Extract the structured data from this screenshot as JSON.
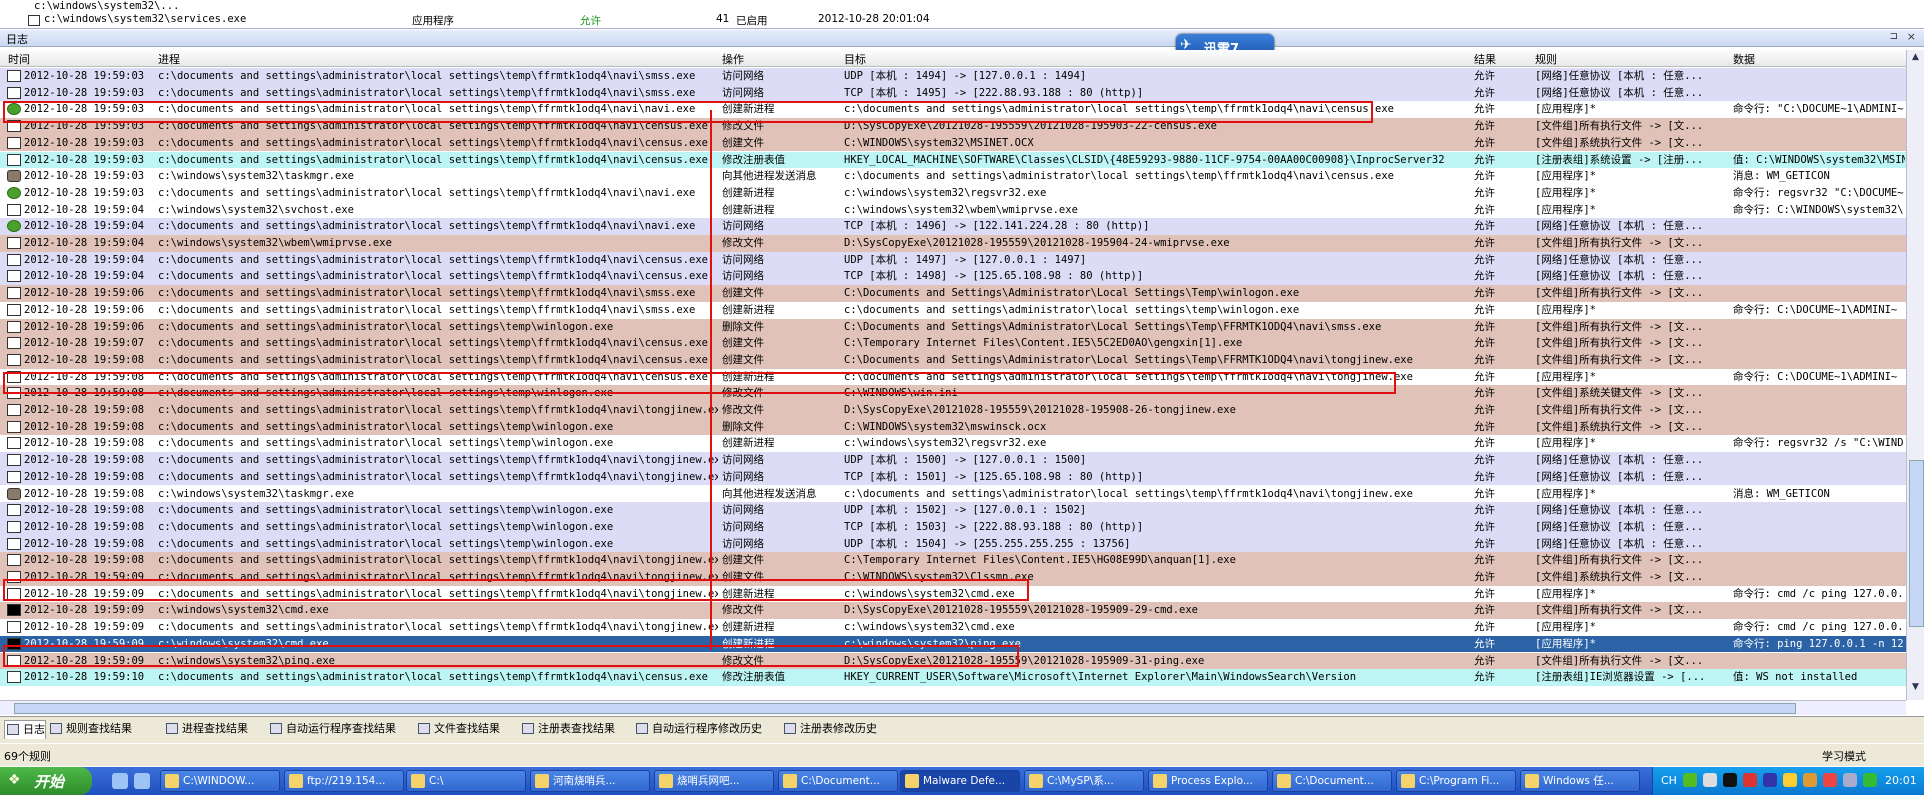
{
  "top_strip": {
    "row1": {
      "path": "c:\\windows\\system32\\...",
      "type": "",
      "status": "",
      "count": "",
      "state": "",
      "time": ""
    },
    "row2": {
      "path": "c:\\windows\\system32\\services.exe",
      "type": "应用程序",
      "status": "允许",
      "count": "41",
      "state": "已启用",
      "time": "2012-10-28 20:01:04"
    }
  },
  "log_panel": {
    "title": "日志",
    "pin": "⊐",
    "close": "×"
  },
  "xunlei": {
    "label": "迅雷7"
  },
  "columns": {
    "time": "时间",
    "process": "进程",
    "operation": "操作",
    "target": "目标",
    "result": "结果",
    "rule": "规则",
    "data": "数据"
  },
  "rows": [
    {
      "bg": "lav",
      "icon": "w",
      "time": "2012-10-28 19:59:03",
      "proc": "c:\\documents and settings\\administrator\\local settings\\temp\\ffrmtk1odq4\\navi\\smss.exe",
      "op": "访问网络",
      "target": "UDP [本机 : 1494] -> [127.0.0.1 : 1494]",
      "res": "允许",
      "rule": "[网络]任意协议 [本机 : 任意...",
      "data": ""
    },
    {
      "bg": "lav",
      "icon": "w",
      "time": "2012-10-28 19:59:03",
      "proc": "c:\\documents and settings\\administrator\\local settings\\temp\\ffrmtk1odq4\\navi\\smss.exe",
      "op": "访问网络",
      "target": "TCP [本机 : 1495] -> [222.88.93.188 : 80 (http)]",
      "res": "允许",
      "rule": "[网络]任意协议 [本机 : 任意...",
      "data": ""
    },
    {
      "bg": "white",
      "icon": "g",
      "time": "2012-10-28 19:59:03",
      "proc": "c:\\documents and settings\\administrator\\local settings\\temp\\ffrmtk1odq4\\navi\\navi.exe",
      "op": "创建新进程",
      "target": "c:\\documents and settings\\administrator\\local settings\\temp\\ffrmtk1odq4\\navi\\census.exe",
      "res": "允许",
      "rule": "[应用程序]*",
      "data": "命令行: \"C:\\DOCUME~1\\ADMINI~"
    },
    {
      "bg": "pink",
      "icon": "w",
      "time": "2012-10-28 19:59:03",
      "proc": "c:\\documents and settings\\administrator\\local settings\\temp\\ffrmtk1odq4\\navi\\census.exe",
      "op": "修改文件",
      "target": "D:\\SysCopyExe\\20121028-195559\\20121028-195903-22-census.exe",
      "res": "允许",
      "rule": "[文件组]所有执行文件 -> [文...",
      "data": ""
    },
    {
      "bg": "pink",
      "icon": "w",
      "time": "2012-10-28 19:59:03",
      "proc": "c:\\documents and settings\\administrator\\local settings\\temp\\ffrmtk1odq4\\navi\\census.exe",
      "op": "创建文件",
      "target": "C:\\WINDOWS\\system32\\MSINET.OCX",
      "res": "允许",
      "rule": "[文件组]系统执行文件 -> [文...",
      "data": ""
    },
    {
      "bg": "cyan",
      "icon": "w",
      "time": "2012-10-28 19:59:03",
      "proc": "c:\\documents and settings\\administrator\\local settings\\temp\\ffrmtk1odq4\\navi\\census.exe",
      "op": "修改注册表值",
      "target": "HKEY_LOCAL_MACHINE\\SOFTWARE\\Classes\\CLSID\\{48E59293-9880-11CF-9754-00AA00C00908}\\InprocServer32",
      "res": "允许",
      "rule": "[注册表组]系统设置 -> [注册...",
      "data": "值: C:\\WINDOWS\\system32\\MSIN"
    },
    {
      "bg": "white",
      "icon": "u",
      "time": "2012-10-28 19:59:03",
      "proc": "c:\\windows\\system32\\taskmgr.exe",
      "op": "向其他进程发送消息",
      "target": "c:\\documents and settings\\administrator\\local settings\\temp\\ffrmtk1odq4\\navi\\census.exe",
      "res": "允许",
      "rule": "[应用程序]*",
      "data": "消息: WM_GETICON"
    },
    {
      "bg": "white",
      "icon": "g",
      "time": "2012-10-28 19:59:03",
      "proc": "c:\\documents and settings\\administrator\\local settings\\temp\\ffrmtk1odq4\\navi\\navi.exe",
      "op": "创建新进程",
      "target": "c:\\windows\\system32\\regsvr32.exe",
      "res": "允许",
      "rule": "[应用程序]*",
      "data": "命令行: regsvr32 \"C:\\DOCUME~"
    },
    {
      "bg": "white",
      "icon": "w",
      "time": "2012-10-28 19:59:04",
      "proc": "c:\\windows\\system32\\svchost.exe",
      "op": "创建新进程",
      "target": "c:\\windows\\system32\\wbem\\wmiprvse.exe",
      "res": "允许",
      "rule": "[应用程序]*",
      "data": "命令行: C:\\WINDOWS\\system32\\"
    },
    {
      "bg": "lav",
      "icon": "g",
      "time": "2012-10-28 19:59:04",
      "proc": "c:\\documents and settings\\administrator\\local settings\\temp\\ffrmtk1odq4\\navi\\navi.exe",
      "op": "访问网络",
      "target": "TCP [本机 : 1496] -> [122.141.224.28 : 80 (http)]",
      "res": "允许",
      "rule": "[网络]任意协议 [本机 : 任意...",
      "data": ""
    },
    {
      "bg": "pink",
      "icon": "w",
      "time": "2012-10-28 19:59:04",
      "proc": "c:\\windows\\system32\\wbem\\wmiprvse.exe",
      "op": "修改文件",
      "target": "D:\\SysCopyExe\\20121028-195559\\20121028-195904-24-wmiprvse.exe",
      "res": "允许",
      "rule": "[文件组]所有执行文件 -> [文...",
      "data": ""
    },
    {
      "bg": "lav",
      "icon": "w",
      "time": "2012-10-28 19:59:04",
      "proc": "c:\\documents and settings\\administrator\\local settings\\temp\\ffrmtk1odq4\\navi\\census.exe",
      "op": "访问网络",
      "target": "UDP [本机 : 1497] -> [127.0.0.1 : 1497]",
      "res": "允许",
      "rule": "[网络]任意协议 [本机 : 任意...",
      "data": ""
    },
    {
      "bg": "lav",
      "icon": "w",
      "time": "2012-10-28 19:59:04",
      "proc": "c:\\documents and settings\\administrator\\local settings\\temp\\ffrmtk1odq4\\navi\\census.exe",
      "op": "访问网络",
      "target": "TCP [本机 : 1498] -> [125.65.108.98 : 80 (http)]",
      "res": "允许",
      "rule": "[网络]任意协议 [本机 : 任意...",
      "data": ""
    },
    {
      "bg": "pink",
      "icon": "w",
      "time": "2012-10-28 19:59:06",
      "proc": "c:\\documents and settings\\administrator\\local settings\\temp\\ffrmtk1odq4\\navi\\smss.exe",
      "op": "创建文件",
      "target": "C:\\Documents and Settings\\Administrator\\Local Settings\\Temp\\winlogon.exe",
      "res": "允许",
      "rule": "[文件组]所有执行文件 -> [文...",
      "data": ""
    },
    {
      "bg": "white",
      "icon": "w",
      "time": "2012-10-28 19:59:06",
      "proc": "c:\\documents and settings\\administrator\\local settings\\temp\\ffrmtk1odq4\\navi\\smss.exe",
      "op": "创建新进程",
      "target": "c:\\documents and settings\\administrator\\local settings\\temp\\winlogon.exe",
      "res": "允许",
      "rule": "[应用程序]*",
      "data": "命令行: C:\\DOCUME~1\\ADMINI~"
    },
    {
      "bg": "pink",
      "icon": "w",
      "time": "2012-10-28 19:59:06",
      "proc": "c:\\documents and settings\\administrator\\local settings\\temp\\winlogon.exe",
      "op": "删除文件",
      "target": "C:\\Documents and Settings\\Administrator\\Local Settings\\Temp\\FFRMTK1ODQ4\\navi\\smss.exe",
      "res": "允许",
      "rule": "[文件组]所有执行文件 -> [文...",
      "data": ""
    },
    {
      "bg": "pink",
      "icon": "w",
      "time": "2012-10-28 19:59:07",
      "proc": "c:\\documents and settings\\administrator\\local settings\\temp\\ffrmtk1odq4\\navi\\census.exe",
      "op": "创建文件",
      "target": "C:\\Temporary Internet Files\\Content.IE5\\5C2ED0AO\\gengxin[1].exe",
      "res": "允许",
      "rule": "[文件组]所有执行文件 -> [文...",
      "data": ""
    },
    {
      "bg": "pink",
      "icon": "w",
      "time": "2012-10-28 19:59:08",
      "proc": "c:\\documents and settings\\administrator\\local settings\\temp\\ffrmtk1odq4\\navi\\census.exe",
      "op": "创建文件",
      "target": "C:\\Documents and Settings\\Administrator\\Local Settings\\Temp\\FFRMTK1ODQ4\\navi\\tongjinew.exe",
      "res": "允许",
      "rule": "[文件组]所有执行文件 -> [文...",
      "data": ""
    },
    {
      "bg": "white",
      "icon": "w",
      "time": "2012-10-28 19:59:08",
      "proc": "c:\\documents and settings\\administrator\\local settings\\temp\\ffrmtk1odq4\\navi\\census.exe",
      "op": "创建新进程",
      "target": "c:\\documents and settings\\administrator\\local settings\\temp\\ffrmtk1odq4\\navi\\tongjinew.exe",
      "res": "允许",
      "rule": "[应用程序]*",
      "data": "命令行: C:\\DOCUME~1\\ADMINI~"
    },
    {
      "bg": "pink",
      "icon": "w",
      "time": "2012-10-28 19:59:08",
      "proc": "c:\\documents and settings\\administrator\\local settings\\temp\\winlogon.exe",
      "op": "修改文件",
      "target": "C:\\WINDOWS\\win.ini",
      "res": "允许",
      "rule": "[文件组]系统关键文件 -> [文...",
      "data": ""
    },
    {
      "bg": "pink",
      "icon": "w",
      "time": "2012-10-28 19:59:08",
      "proc": "c:\\documents and settings\\administrator\\local settings\\temp\\ffrmtk1odq4\\navi\\tongjinew.exe",
      "op": "修改文件",
      "target": "D:\\SysCopyExe\\20121028-195559\\20121028-195908-26-tongjinew.exe",
      "res": "允许",
      "rule": "[文件组]所有执行文件 -> [文...",
      "data": ""
    },
    {
      "bg": "pink",
      "icon": "w",
      "time": "2012-10-28 19:59:08",
      "proc": "c:\\documents and settings\\administrator\\local settings\\temp\\winlogon.exe",
      "op": "删除文件",
      "target": "C:\\WINDOWS\\system32\\mswinsck.ocx",
      "res": "允许",
      "rule": "[文件组]系统执行文件 -> [文...",
      "data": ""
    },
    {
      "bg": "white",
      "icon": "w",
      "time": "2012-10-28 19:59:08",
      "proc": "c:\\documents and settings\\administrator\\local settings\\temp\\winlogon.exe",
      "op": "创建新进程",
      "target": "c:\\windows\\system32\\regsvr32.exe",
      "res": "允许",
      "rule": "[应用程序]*",
      "data": "命令行: regsvr32 /s \"C:\\WIND"
    },
    {
      "bg": "lav",
      "icon": "w",
      "time": "2012-10-28 19:59:08",
      "proc": "c:\\documents and settings\\administrator\\local settings\\temp\\ffrmtk1odq4\\navi\\tongjinew.exe",
      "op": "访问网络",
      "target": "UDP [本机 : 1500] -> [127.0.0.1 : 1500]",
      "res": "允许",
      "rule": "[网络]任意协议 [本机 : 任意...",
      "data": ""
    },
    {
      "bg": "lav",
      "icon": "w",
      "time": "2012-10-28 19:59:08",
      "proc": "c:\\documents and settings\\administrator\\local settings\\temp\\ffrmtk1odq4\\navi\\tongjinew.exe",
      "op": "访问网络",
      "target": "TCP [本机 : 1501] -> [125.65.108.98 : 80 (http)]",
      "res": "允许",
      "rule": "[网络]任意协议 [本机 : 任意...",
      "data": ""
    },
    {
      "bg": "white",
      "icon": "u",
      "time": "2012-10-28 19:59:08",
      "proc": "c:\\windows\\system32\\taskmgr.exe",
      "op": "向其他进程发送消息",
      "target": "c:\\documents and settings\\administrator\\local settings\\temp\\ffrmtk1odq4\\navi\\tongjinew.exe",
      "res": "允许",
      "rule": "[应用程序]*",
      "data": "消息: WM_GETICON"
    },
    {
      "bg": "lav",
      "icon": "w",
      "time": "2012-10-28 19:59:08",
      "proc": "c:\\documents and settings\\administrator\\local settings\\temp\\winlogon.exe",
      "op": "访问网络",
      "target": "UDP [本机 : 1502] -> [127.0.0.1 : 1502]",
      "res": "允许",
      "rule": "[网络]任意协议 [本机 : 任意...",
      "data": ""
    },
    {
      "bg": "lav",
      "icon": "w",
      "time": "2012-10-28 19:59:08",
      "proc": "c:\\documents and settings\\administrator\\local settings\\temp\\winlogon.exe",
      "op": "访问网络",
      "target": "TCP [本机 : 1503] -> [222.88.93.188 : 80 (http)]",
      "res": "允许",
      "rule": "[网络]任意协议 [本机 : 任意...",
      "data": ""
    },
    {
      "bg": "lav",
      "icon": "w",
      "time": "2012-10-28 19:59:08",
      "proc": "c:\\documents and settings\\administrator\\local settings\\temp\\winlogon.exe",
      "op": "访问网络",
      "target": "UDP [本机 : 1504] -> [255.255.255.255 : 13756]",
      "res": "允许",
      "rule": "[网络]任意协议 [本机 : 任意...",
      "data": ""
    },
    {
      "bg": "pink",
      "icon": "w",
      "time": "2012-10-28 19:59:08",
      "proc": "c:\\documents and settings\\administrator\\local settings\\temp\\ffrmtk1odq4\\navi\\tongjinew.exe",
      "op": "创建文件",
      "target": "C:\\Temporary Internet Files\\Content.IE5\\HG08E99D\\anquan[1].exe",
      "res": "允许",
      "rule": "[文件组]所有执行文件 -> [文...",
      "data": ""
    },
    {
      "bg": "pink",
      "icon": "w",
      "time": "2012-10-28 19:59:09",
      "proc": "c:\\documents and settings\\administrator\\local settings\\temp\\ffrmtk1odq4\\navi\\tongjinew.exe",
      "op": "创建文件",
      "target": "C:\\WINDOWS\\system32\\Clssmn.exe",
      "res": "允许",
      "rule": "[文件组]系统执行文件 -> [文...",
      "data": ""
    },
    {
      "bg": "white",
      "icon": "w",
      "time": "2012-10-28 19:59:09",
      "proc": "c:\\documents and settings\\administrator\\local settings\\temp\\ffrmtk1odq4\\navi\\tongjinew.exe",
      "op": "创建新进程",
      "target": "c:\\windows\\system32\\cmd.exe",
      "res": "允许",
      "rule": "[应用程序]*",
      "data": "命令行: cmd /c ping 127.0.0."
    },
    {
      "bg": "pink",
      "icon": "c",
      "time": "2012-10-28 19:59:09",
      "proc": "c:\\windows\\system32\\cmd.exe",
      "op": "修改文件",
      "target": "D:\\SysCopyExe\\20121028-195559\\20121028-195909-29-cmd.exe",
      "res": "允许",
      "rule": "[文件组]所有执行文件 -> [文...",
      "data": ""
    },
    {
      "bg": "white",
      "icon": "w",
      "time": "2012-10-28 19:59:09",
      "proc": "c:\\documents and settings\\administrator\\local settings\\temp\\ffrmtk1odq4\\navi\\tongjinew.exe",
      "op": "创建新进程",
      "target": "c:\\windows\\system32\\cmd.exe",
      "res": "允许",
      "rule": "[应用程序]*",
      "data": "命令行: cmd /c ping 127.0.0."
    },
    {
      "bg": "sel",
      "icon": "c",
      "time": "2012-10-28 19:59:09",
      "proc": "c:\\windows\\system32\\cmd.exe",
      "op": "创建新进程",
      "target": "c:\\windows\\system32\\ping.exe",
      "res": "允许",
      "rule": "[应用程序]*",
      "data": "命令行: ping 127.0.0.1 -n 12"
    },
    {
      "bg": "pink",
      "icon": "w",
      "time": "2012-10-28 19:59:09",
      "proc": "c:\\windows\\system32\\ping.exe",
      "op": "修改文件",
      "target": "D:\\SysCopyExe\\20121028-195559\\20121028-195909-31-ping.exe",
      "res": "允许",
      "rule": "[文件组]所有执行文件 -> [文...",
      "data": ""
    },
    {
      "bg": "cyan",
      "icon": "w",
      "time": "2012-10-28 19:59:10",
      "proc": "c:\\documents and settings\\administrator\\local settings\\temp\\ffrmtk1odq4\\navi\\census.exe",
      "op": "修改注册表值",
      "target": "HKEY_CURRENT_USER\\Software\\Microsoft\\Internet Explorer\\Main\\WindowsSearch\\Version",
      "res": "允许",
      "rule": "[注册表组]IE浏览器设置 -> [...",
      "data": "值: WS not installed"
    }
  ],
  "tabs": [
    "日志",
    "规则查找结果",
    "进程查找结果",
    "自动运行程序查找结果",
    "文件查找结果",
    "注册表查找结果",
    "自动运行程序修改历史",
    "注册表修改历史"
  ],
  "status": {
    "left": "69个规则",
    "right": "学习模式"
  },
  "taskbar": {
    "start": "开始",
    "tasks": [
      "C:\\WINDOW...",
      "ftp://219.154...",
      "C:\\",
      "河南烧哨兵...",
      "烧哨兵网吧...",
      "C:\\Document...",
      "Malware Defe...",
      "C:\\MySP\\系...",
      "Process Explo...",
      "C:\\Document...",
      "C:\\Program Fi...",
      "Windows 任..."
    ],
    "tray_lang": "CH",
    "clock": "20:01"
  }
}
